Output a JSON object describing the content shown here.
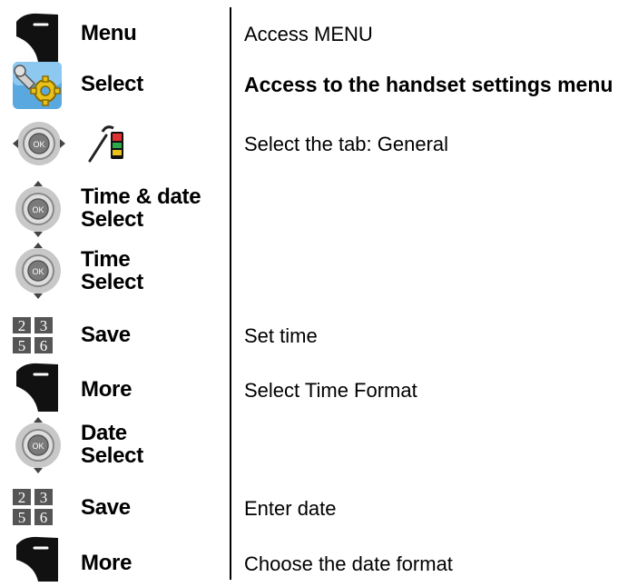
{
  "colors": {
    "softkey": "#111111",
    "nav_gray": "#b8b8b8",
    "nav_ok": "#7a7a7a",
    "keypad_bg": "#4a4a4a",
    "settings_yellow": "#e8c21a",
    "settings_blue": "#3a8fd0"
  },
  "rows": [
    {
      "icon": "softkey-icon",
      "key": "Menu",
      "desc": "Access MENU"
    },
    {
      "icon": "settings-icon",
      "key": "Select",
      "desc": "Access to the handset settings menu"
    },
    {
      "icon": "nav-left-right-icon",
      "icon2": "general-tab-icon",
      "key": "",
      "desc": "Select the tab: General"
    },
    {
      "icon": "nav-up-down-icon",
      "key": "Time & date",
      "key2": "Select",
      "desc": ""
    },
    {
      "icon": "nav-up-down-icon",
      "key": "Time",
      "key2": "Select",
      "desc": ""
    },
    {
      "icon": "keypad-icon",
      "key": "Save",
      "desc": "Set time",
      "keypad": [
        "2",
        "3",
        "5",
        "6"
      ]
    },
    {
      "icon": "softkey-icon",
      "key": "More",
      "desc": "Select Time Format"
    },
    {
      "icon": "nav-up-down-icon",
      "key": "Date",
      "key2": "Select",
      "desc": ""
    },
    {
      "icon": "keypad-icon",
      "key": "Save",
      "desc": "Enter date",
      "keypad": [
        "2",
        "3",
        "5",
        "6"
      ]
    },
    {
      "icon": "softkey-icon",
      "key": "More",
      "desc": "Choose the date format"
    }
  ],
  "nav_label": "OK"
}
